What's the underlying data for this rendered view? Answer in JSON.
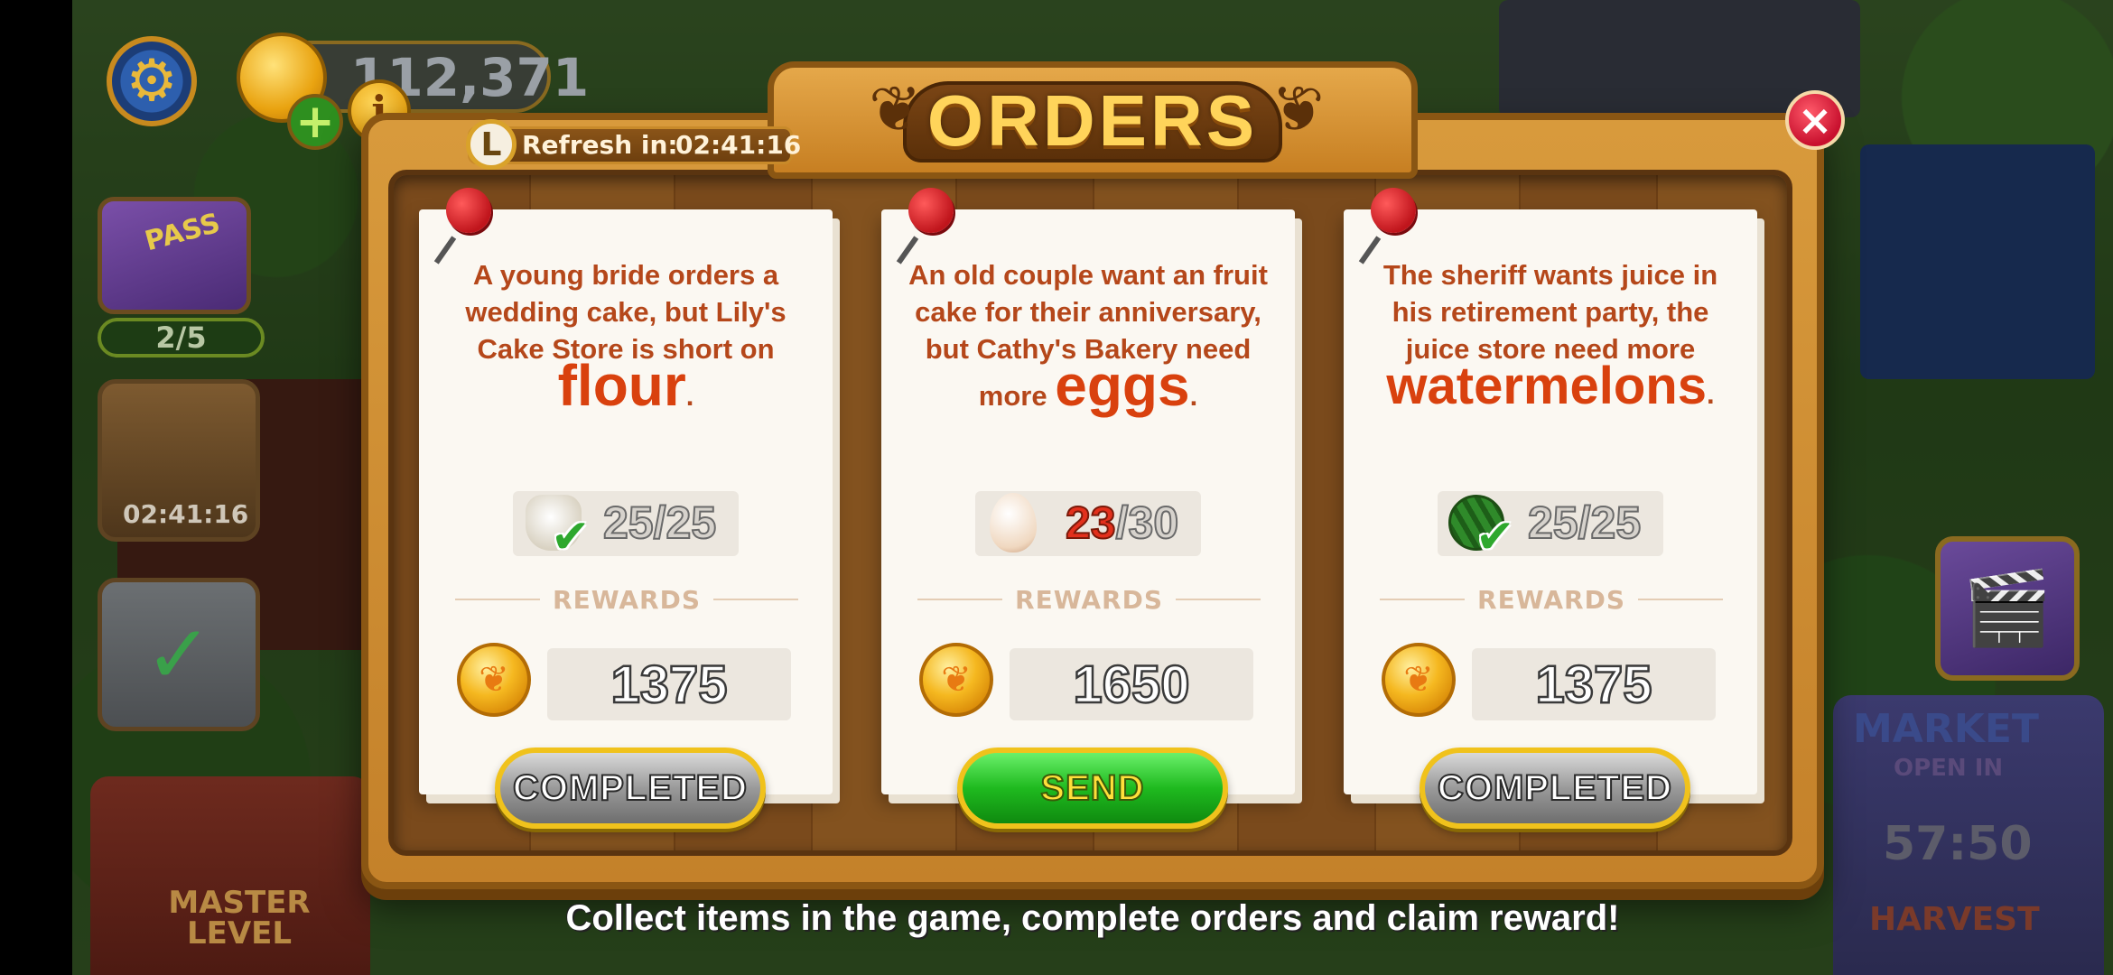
{
  "hud": {
    "coins": "112,371",
    "plus": "+",
    "info": "i",
    "pass_label": "PASS",
    "pass_progress": "2/5",
    "basket_timer": "02:41:16",
    "master_level_label": "MASTER\nLEVEL",
    "market_label": "MARKET",
    "open_in_label": "OPEN IN",
    "market_timer": "57:50",
    "harvest_label": "HARVEST"
  },
  "modal": {
    "title": "ORDERS",
    "refresh_label": "Refresh in:",
    "refresh_time": "02:41:16",
    "close": "×"
  },
  "orders": [
    {
      "text_before": "A young bride orders a wedding cake, but Lily's Cake Store is short on",
      "highlight": "flour",
      "item": "flour-sack-icon",
      "have": "25",
      "need": "/25",
      "have_fraction": 1.0,
      "rewards_label": "REWARDS",
      "reward": "1375",
      "button": "COMPLETED",
      "state": "completed"
    },
    {
      "text_before": "An old couple want an fruit cake for their anniversary, but Cathy's Bakery need",
      "text_more": "more",
      "highlight": "eggs",
      "item": "egg-icon",
      "have": "23",
      "need": "/30",
      "have_fraction": 0.77,
      "rewards_label": "REWARDS",
      "reward": "1650",
      "button": "SEND",
      "state": "send"
    },
    {
      "text_before": "The sheriff wants juice in his retirement party, the juice store need more",
      "highlight": "watermelons",
      "item": "watermelon-icon",
      "have": "25",
      "need": "/25",
      "have_fraction": 1.0,
      "rewards_label": "REWARDS",
      "reward": "1375",
      "button": "COMPLETED",
      "state": "completed"
    }
  ],
  "footer_hint": "Collect items in the game, complete orders and claim reward!",
  "colors": {
    "accent_gold": "#ffd45a",
    "wood": "#c4812a",
    "card_text": "#b5471a",
    "send_green": "#1fba1f",
    "shortfall_red": "#e3301c"
  }
}
